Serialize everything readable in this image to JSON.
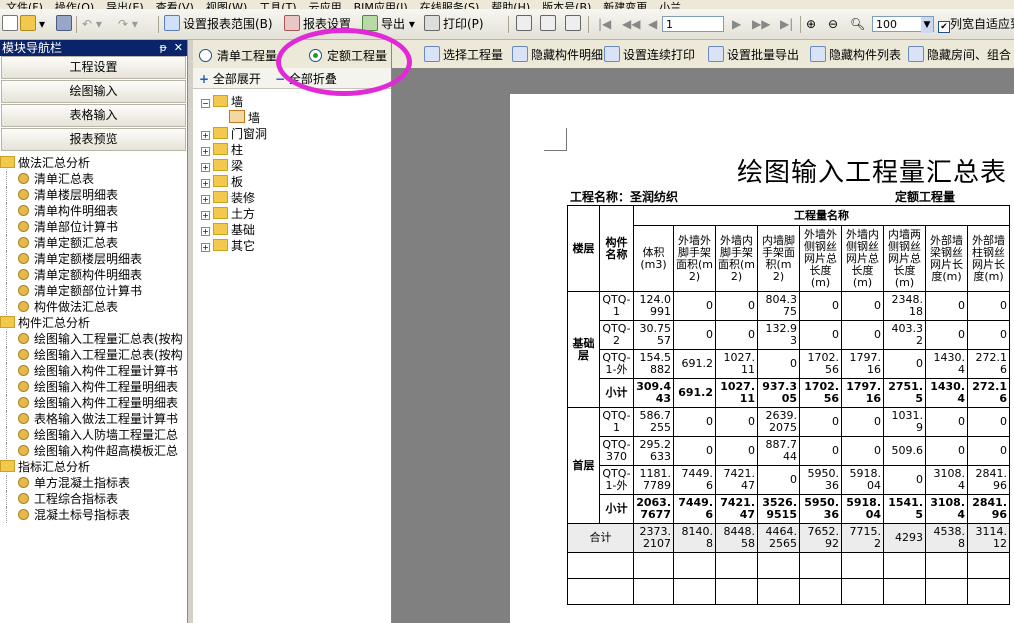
{
  "menu": [
    "文件(F)",
    "操作(O)",
    "导出(E)",
    "查看(V)",
    "视图(W)",
    "工具(T)",
    "云应用",
    "BIM应用(I)",
    "在线服务(S)",
    "帮助(H)",
    "版本号(B)",
    "新建变更",
    "小兰"
  ],
  "toolbar": {
    "report_range_label": "设置报表范围(B)",
    "report_settings_label": "报表设置",
    "export_label": "导出",
    "print_label": "打印(P)",
    "page_value": "1",
    "zoom_value": "100",
    "auto_fit_label": "列宽自适应到"
  },
  "nav": {
    "title": "模块导航栏",
    "pin": "ᵽ",
    "close": "✕",
    "buttons": [
      "工程设置",
      "绘图输入",
      "表格输入",
      "报表预览"
    ],
    "groups": [
      {
        "label": "做法汇总分析",
        "items": [
          "清单汇总表",
          "清单楼层明细表",
          "清单构件明细表",
          "清单部位计算书",
          "清单定额汇总表",
          "清单定额楼层明细表",
          "清单定额构件明细表",
          "清单定额部位计算书",
          "构件做法汇总表"
        ]
      },
      {
        "label": "构件汇总分析",
        "items": [
          "绘图输入工程量汇总表(按构",
          "绘图输入工程量汇总表(按构",
          "绘图输入构件工程量计算书",
          "绘图输入构件工程量明细表",
          "绘图输入构件工程量明细表",
          "表格输入做法工程量计算书",
          "绘图输入人防墙工程量汇总",
          "绘图输入构件超高模板汇总"
        ]
      },
      {
        "label": "指标汇总分析",
        "items": [
          "单方混凝土指标表",
          "工程综合指标表",
          "混凝土标号指标表"
        ]
      }
    ]
  },
  "mid": {
    "radio_list": "清单工程量",
    "radio_quota": "定额工程量",
    "expand_all": "全部展开",
    "collapse_all": "全部折叠",
    "root": "墙",
    "root_child": "墙",
    "folders": [
      "门窗洞",
      "柱",
      "梁",
      "板",
      "装修",
      "土方",
      "基础",
      "其它"
    ]
  },
  "right_toolbar": [
    "选择工程量",
    "隐藏构件明细",
    "设置连续打印",
    "设置批量导出",
    "隐藏构件列表",
    "隐藏房间、组合"
  ],
  "report": {
    "title": "绘图输入工程量汇总表",
    "project_label": "工程名称：圣润纺织",
    "type_label": "定额工程量",
    "group_header": "工程量名称",
    "col_floor": "楼层",
    "col_name": "构件名称",
    "columns": [
      "体积(m3)",
      "外墙外脚手架面积(m2)",
      "外墙内脚手架面积(m2)",
      "内墙脚手架面积(m2)",
      "外墙外侧钢丝网片总长度(m)",
      "外墙内侧钢丝网片总长度(m)",
      "内墙两侧钢丝网片总长度(m)",
      "外部墙梁钢丝网片长度(m)",
      "外部墙柱钢丝网片长度(m)"
    ],
    "floors": [
      {
        "floor": "基础层",
        "rows": [
          {
            "name": "QTQ-1",
            "vals": [
              "124.0991",
              "0",
              "0",
              "804.375",
              "0",
              "0",
              "2348.18",
              "0",
              "0"
            ]
          },
          {
            "name": "QTQ-2",
            "vals": [
              "30.7557",
              "0",
              "0",
              "132.93",
              "0",
              "0",
              "403.32",
              "0",
              "0"
            ]
          },
          {
            "name": "QTQ-1-外",
            "vals": [
              "154.5882",
              "691.2",
              "1027.11",
              "0",
              "1702.56",
              "1797.16",
              "0",
              "1430.4",
              "272.16"
            ]
          },
          {
            "name": "小计",
            "vals": [
              "309.443",
              "691.2",
              "1027.11",
              "937.305",
              "1702.56",
              "1797.16",
              "2751.5",
              "1430.4",
              "272.16"
            ],
            "bold": true
          }
        ]
      },
      {
        "floor": "首层",
        "rows": [
          {
            "name": "QTQ-1",
            "vals": [
              "586.7255",
              "0",
              "0",
              "2639.2075",
              "0",
              "0",
              "1031.9",
              "0",
              "0"
            ]
          },
          {
            "name": "QTQ-370",
            "vals": [
              "295.2633",
              "0",
              "0",
              "887.744",
              "0",
              "0",
              "509.6",
              "0",
              "0"
            ]
          },
          {
            "name": "QTQ-1-外",
            "vals": [
              "1181.7789",
              "7449.6",
              "7421.47",
              "0",
              "5950.36",
              "5918.04",
              "0",
              "3108.4",
              "2841.96"
            ]
          },
          {
            "name": "小计",
            "vals": [
              "2063.7677",
              "7449.6",
              "7421.47",
              "3526.9515",
              "5950.36",
              "5918.04",
              "1541.5",
              "3108.4",
              "2841.96"
            ],
            "bold": true
          }
        ]
      }
    ],
    "total_label": "合计",
    "total_vals": [
      "2373.2107",
      "8140.8",
      "8448.58",
      "4464.2565",
      "7652.92",
      "7715.2",
      "4293",
      "4538.8",
      "3114.12"
    ]
  }
}
